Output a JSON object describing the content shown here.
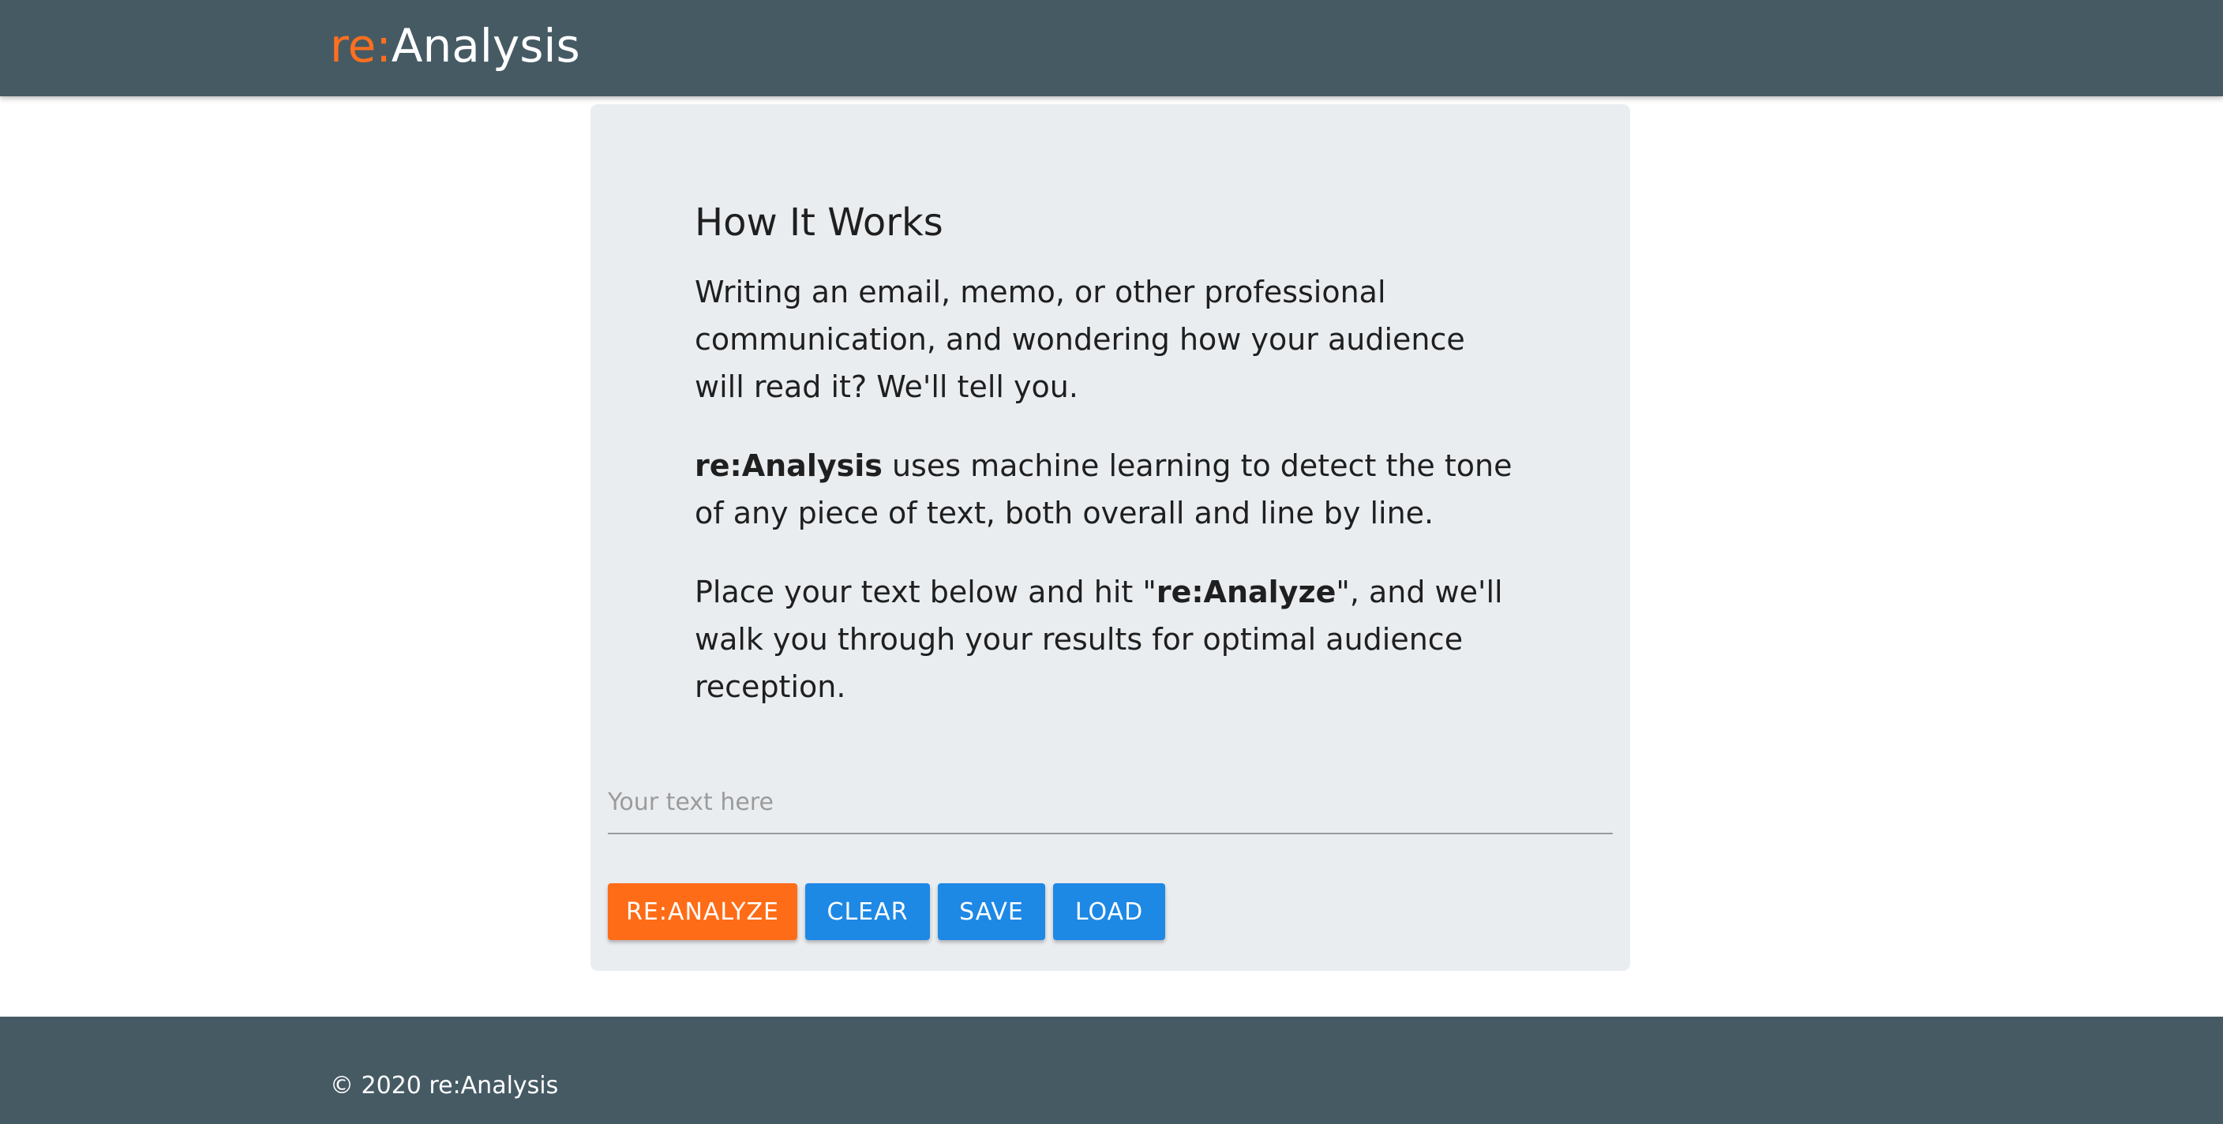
{
  "navbar": {
    "brand_prefix": "re:",
    "brand_name": "Analysis"
  },
  "intro": {
    "heading": "How It Works",
    "paragraph1": "Writing an email, memo, or other professional communication, and wondering how your audience will read it? We'll tell you.",
    "paragraph2_bold": "re:Analysis",
    "paragraph2_rest": " uses machine learning to detect the tone of any piece of text, both overall and line by line.",
    "paragraph3_before": "Place your text below and hit \"",
    "paragraph3_bold": "re:Analyze",
    "paragraph3_after": "\", and we'll walk you through your results for optimal audience reception."
  },
  "input": {
    "placeholder": "Your text here",
    "value": ""
  },
  "buttons": {
    "analyze": "RE:ANALYZE",
    "clear": "CLEAR",
    "save": "SAVE",
    "load": "LOAD"
  },
  "footer": {
    "text": "© 2020 re:Analysis"
  },
  "colors": {
    "header_bg": "#465a64",
    "accent_orange": "#ff6c17",
    "button_blue": "#1e88e5",
    "card_bg": "#eaedf0"
  }
}
